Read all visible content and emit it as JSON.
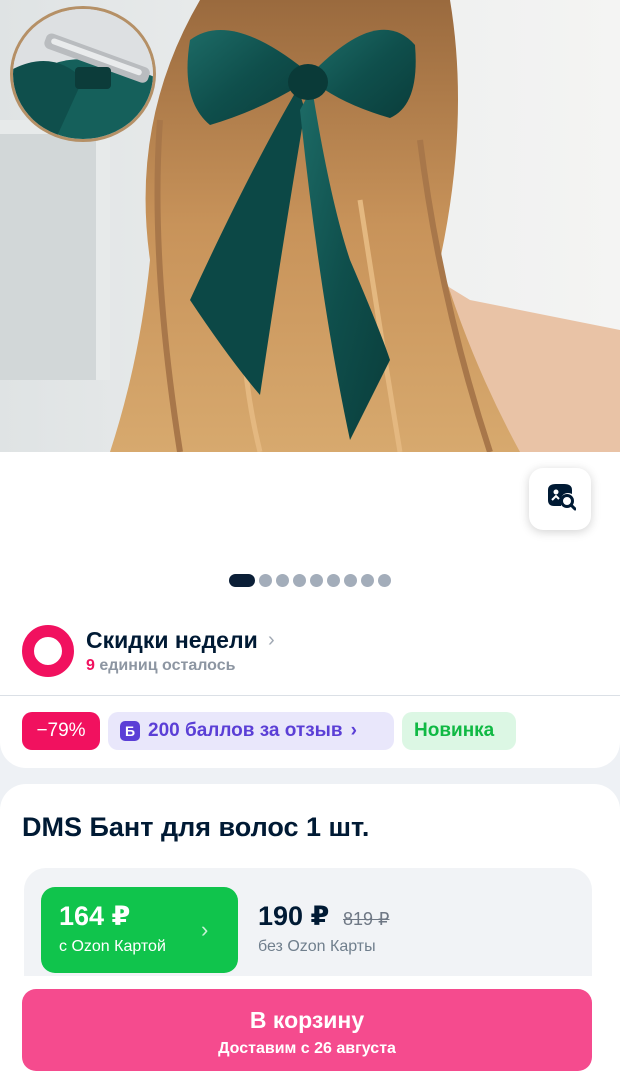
{
  "gallery": {
    "image_alt": "DMS Бант для волос 1 шт.",
    "dot_count": 10,
    "active_index": 0
  },
  "promo": {
    "title": "Скидки недели",
    "remaining_count": "9",
    "remaining_text": "единиц осталось"
  },
  "badges": {
    "discount": "−79%",
    "bonus": "200 баллов за отзыв",
    "new": "Новинка"
  },
  "product": {
    "title": "DMS Бант для волос 1 шт."
  },
  "price": {
    "ozon_card_price": "164 ₽",
    "ozon_card_label": "с Ozon Картой",
    "regular_price": "190 ₽",
    "old_price": "819 ₽",
    "regular_label": "без Ozon Карты"
  },
  "cart": {
    "button_label": "В корзину",
    "delivery_text": "Доставим с 26 августа"
  },
  "colors": {
    "accent": "#f1115f",
    "cart_button": "#f54b8e",
    "ozon_price": "#10c44c",
    "bonus": "#5b3fd6"
  }
}
